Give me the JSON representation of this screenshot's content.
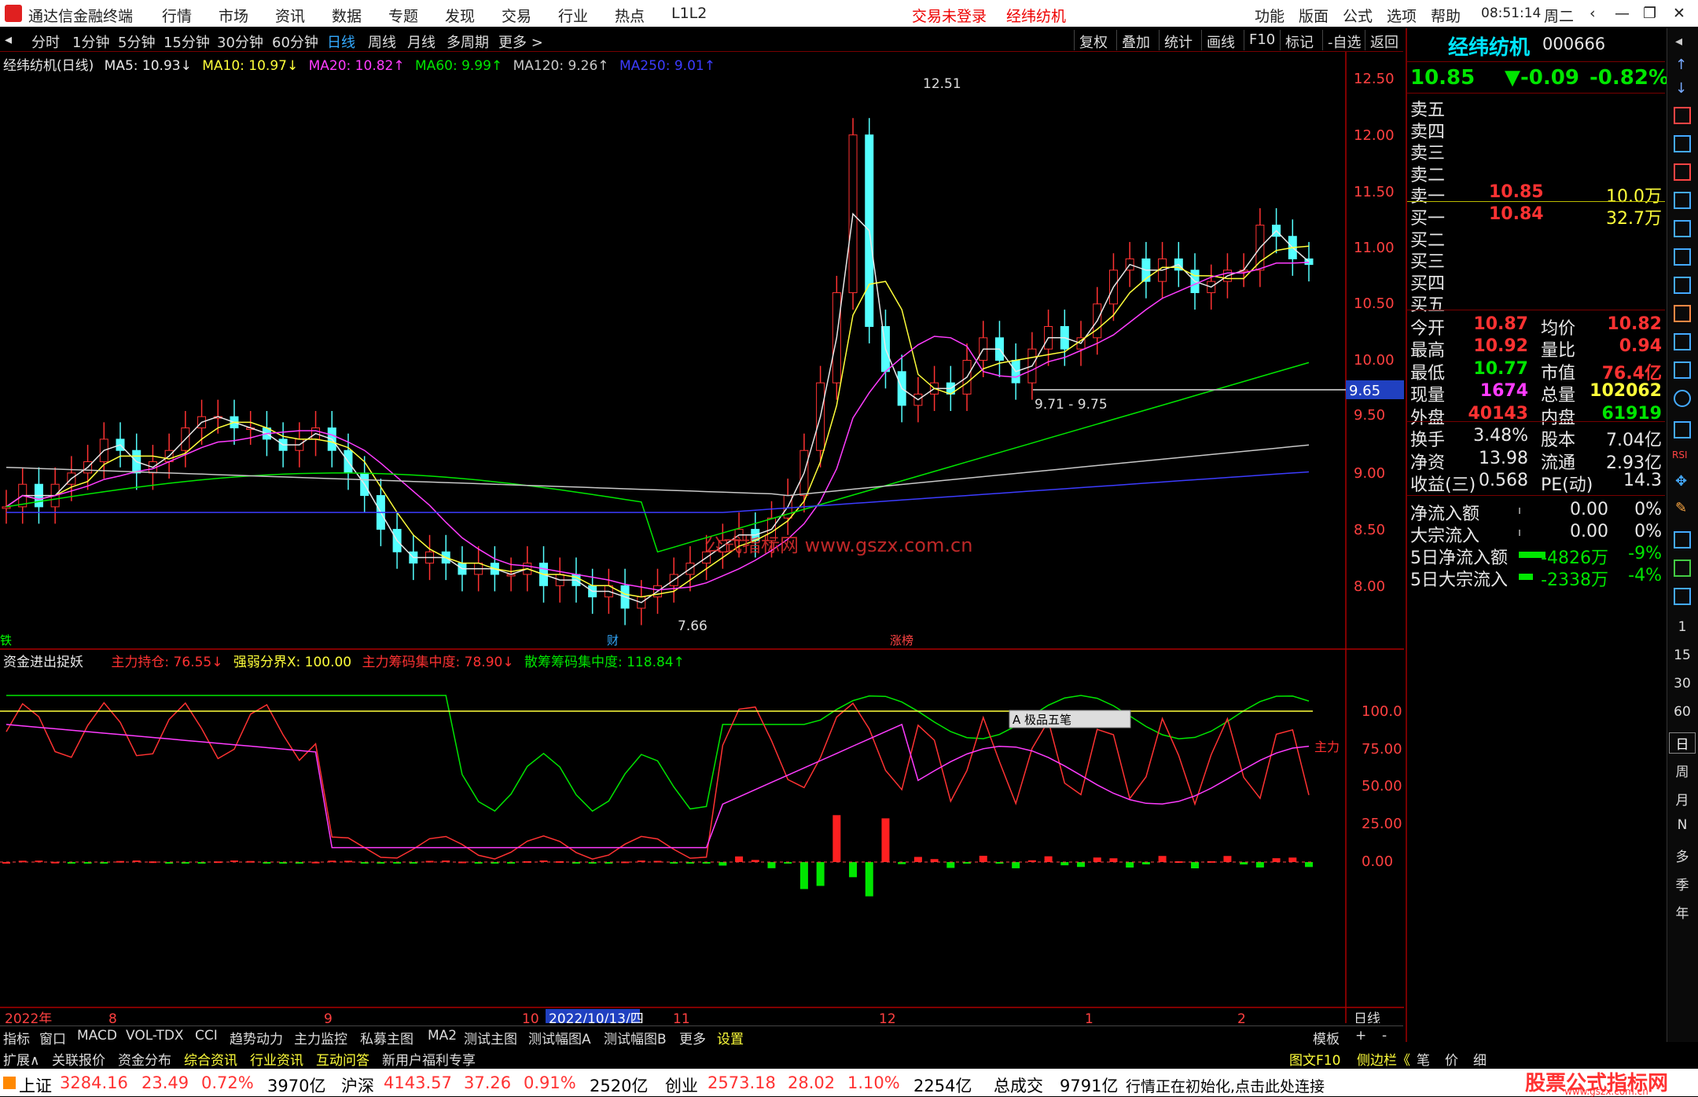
{
  "app": {
    "title": "通达信金融终端",
    "menus": [
      "行情",
      "市场",
      "资讯",
      "数据",
      "专题",
      "发现",
      "交易",
      "行业",
      "热点",
      "L1L2"
    ],
    "center_red": [
      "交易未登录",
      "经纬纺机"
    ],
    "right_menus": [
      "功能",
      "版面",
      "公式",
      "选项",
      "帮助"
    ],
    "time": "08:51:14",
    "weekday": "周二"
  },
  "toolbar": {
    "periods": [
      "分时",
      "1分钟",
      "5分钟",
      "15分钟",
      "30分钟",
      "60分钟",
      "日线",
      "周线",
      "月线",
      "多周期",
      "更多 >"
    ],
    "active": "日线",
    "right": [
      "复权",
      "叠加",
      "统计",
      "画线",
      "F10",
      "标记",
      "-自选",
      "返回"
    ]
  },
  "ma_legend": {
    "name": "经纬纺机(日线)",
    "items": [
      {
        "label": "MA5: 10.93↓",
        "color": "#e8e8e8"
      },
      {
        "label": "MA10: 10.97↓",
        "color": "#ffff3a"
      },
      {
        "label": "MA20: 10.82↑",
        "color": "#ff3cff"
      },
      {
        "label": "MA60: 9.99↑",
        "color": "#00e600"
      },
      {
        "label": "MA120: 9.26↑",
        "color": "#c8c8c8"
      },
      {
        "label": "MA250: 9.01↑",
        "color": "#3c3cff"
      }
    ]
  },
  "price_axis": [
    "12.50",
    "12.00",
    "11.50",
    "11.00",
    "10.50",
    "10.00",
    "9.50",
    "9.00",
    "8.50",
    "8.00"
  ],
  "annotations": {
    "high": "12.51",
    "low": "7.66",
    "range": "9.71 - 9.75",
    "hline": "9.65",
    "watermark": "公式指标网 www.gszx.com.cn",
    "marks": [
      "铁",
      "财",
      "涨榜"
    ]
  },
  "indicator": {
    "name": "资金进出捉妖",
    "items": [
      {
        "label": "主力持仓: 76.55↓",
        "color": "#ff3232"
      },
      {
        "label": "强弱分界X: 100.00",
        "color": "#ffff3a"
      },
      {
        "label": "主力筹码集中度: 78.90↓",
        "color": "#ff3232"
      },
      {
        "label": "散筹筹码集中度: 118.84↑",
        "color": "#00e600"
      }
    ],
    "axis": [
      "100.0",
      "75.00",
      "50.00",
      "25.00",
      "0.00"
    ],
    "popup": "A 极品五笔",
    "right_label": "主力"
  },
  "date_axis": [
    "2022年",
    "8",
    "9",
    "10",
    "2022/10/13/四",
    "11",
    "12",
    "1",
    "2"
  ],
  "period_label": "日线",
  "quote": {
    "name": "经纬纺机",
    "code": "000666",
    "price": "10.85",
    "change": "▼-0.09",
    "pct": "-0.82%",
    "book": [
      {
        "l": "卖五",
        "p": "",
        "v": ""
      },
      {
        "l": "卖四",
        "p": "",
        "v": ""
      },
      {
        "l": "卖三",
        "p": "",
        "v": ""
      },
      {
        "l": "卖二",
        "p": "",
        "v": ""
      },
      {
        "l": "卖一",
        "p": "10.85",
        "v": "10.0万"
      },
      {
        "l": "买一",
        "p": "10.84",
        "v": "32.7万"
      },
      {
        "l": "买二",
        "p": "",
        "v": ""
      },
      {
        "l": "买三",
        "p": "",
        "v": ""
      },
      {
        "l": "买四",
        "p": "",
        "v": ""
      },
      {
        "l": "买五",
        "p": "",
        "v": ""
      }
    ],
    "stats": [
      [
        "今开",
        "10.87",
        "均价",
        "10.82"
      ],
      [
        "最高",
        "10.92",
        "量比",
        "0.94"
      ],
      [
        "最低",
        "10.77",
        "市值",
        "76.4亿"
      ],
      [
        "现量",
        "1674",
        "总量",
        "102062"
      ],
      [
        "外盘",
        "40143",
        "内盘",
        "61919"
      ]
    ],
    "stats2": [
      [
        "换手",
        "3.48%",
        "股本",
        "7.04亿"
      ],
      [
        "净资",
        "13.98",
        "流通",
        "2.93亿"
      ],
      [
        "收益(三)",
        "0.568",
        "PE(动)",
        "14.3"
      ]
    ],
    "flow": [
      [
        "净流入额",
        "0.00",
        "0%"
      ],
      [
        "大宗流入",
        "0.00",
        "0%"
      ],
      [
        "5日净流入额",
        "-4826万",
        "-9%"
      ],
      [
        "5日大宗流入",
        "-2338万",
        "-4%"
      ]
    ]
  },
  "bottom_tabs": [
    "指标",
    "窗口",
    "MACD",
    "VOL-TDX",
    "CCI",
    "趋势动力",
    "主力监控",
    "私募主图",
    "MA2",
    "测试主图",
    "测试幅图A",
    "测试幅图B",
    "更多",
    "设置"
  ],
  "bottom_tabs2": [
    "扩展∧",
    "关联报价",
    "资金分布",
    "综合资讯",
    "行业资讯",
    "互动问答",
    "新用户福利专享"
  ],
  "bottom_right": [
    "模板",
    "+",
    "-"
  ],
  "bottom_right2": [
    "图文F10",
    "侧边栏《",
    "笔",
    "价",
    "细"
  ],
  "status": {
    "indices": [
      {
        "name": "上证",
        "v": "3284.16",
        "c": "23.49",
        "p": "0.72%",
        "a": "3970亿"
      },
      {
        "name": "沪深",
        "v": "4143.57",
        "c": "37.26",
        "p": "0.91%",
        "a": "2520亿"
      },
      {
        "name": "创业",
        "v": "2573.18",
        "c": "28.02",
        "p": "1.10%",
        "a": "2254亿"
      }
    ],
    "total_label": "总成交",
    "total": "9791亿",
    "msg": "行情正在初始化,点击此处连接",
    "brand": "股票公式指标网",
    "brand_url": "www.gszx.com.cn"
  },
  "sidebar_labels": [
    "1",
    "15",
    "30",
    "60",
    "日",
    "周",
    "月",
    "N",
    "多",
    "季",
    "年"
  ]
}
